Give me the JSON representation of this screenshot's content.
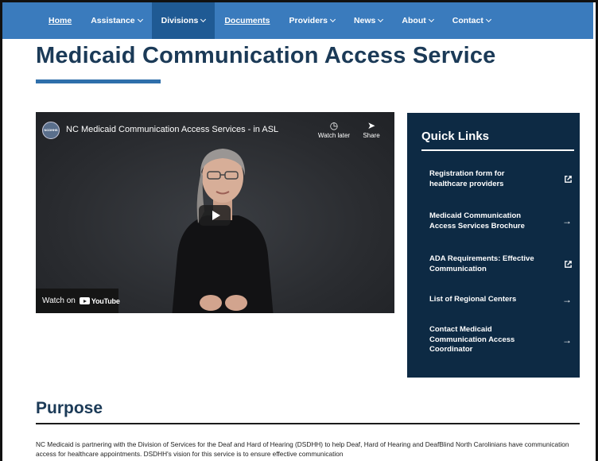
{
  "nav": {
    "items": [
      {
        "label": "Home",
        "dropdown": false,
        "underline": true,
        "active": false
      },
      {
        "label": "Assistance",
        "dropdown": true,
        "underline": false,
        "active": false
      },
      {
        "label": "Divisions",
        "dropdown": true,
        "underline": false,
        "active": true
      },
      {
        "label": "Documents",
        "dropdown": false,
        "underline": true,
        "active": false
      },
      {
        "label": "Providers",
        "dropdown": true,
        "underline": false,
        "active": false
      },
      {
        "label": "News",
        "dropdown": true,
        "underline": false,
        "active": false
      },
      {
        "label": "About",
        "dropdown": true,
        "underline": false,
        "active": false
      },
      {
        "label": "Contact",
        "dropdown": true,
        "underline": false,
        "active": false
      }
    ]
  },
  "page": {
    "title": "Medicaid Communication Access Service"
  },
  "video": {
    "title": "NC Medicaid Communication Access Services - in ASL",
    "channel_logo_text": "NCDHHS",
    "watch_later_label": "Watch later",
    "share_label": "Share",
    "watch_on_label": "Watch on",
    "youtube_label": "YouTube"
  },
  "quick_links": {
    "title": "Quick Links",
    "items": [
      {
        "label": "Registration form for healthcare providers",
        "icon": "external-link-icon"
      },
      {
        "label": "Medicaid Communication Access Services Brochure",
        "icon": "arrow-right-icon"
      },
      {
        "label": "ADA Requirements: Effective Communication",
        "icon": "external-link-icon"
      },
      {
        "label": "List of Regional Centers",
        "icon": "arrow-right-icon"
      },
      {
        "label": "Contact Medicaid Communication Access Coordinator",
        "icon": "arrow-right-icon"
      }
    ]
  },
  "purpose": {
    "heading": "Purpose",
    "body": "NC Medicaid is partnering with the Division of Services for the Deaf and Hard of Hearing (DSDHH) to help Deaf, Hard of Hearing and DeafBlind North Carolinians have communication access for healthcare appointments. DSDHH's vision for this service is to ensure effective communication"
  },
  "colors": {
    "nav_bg": "#3a7bbd",
    "nav_active": "#1f5a94",
    "heading": "#1b3a57",
    "accent_bar": "#2f6fab",
    "quick_links_bg": "#0d2a44"
  }
}
